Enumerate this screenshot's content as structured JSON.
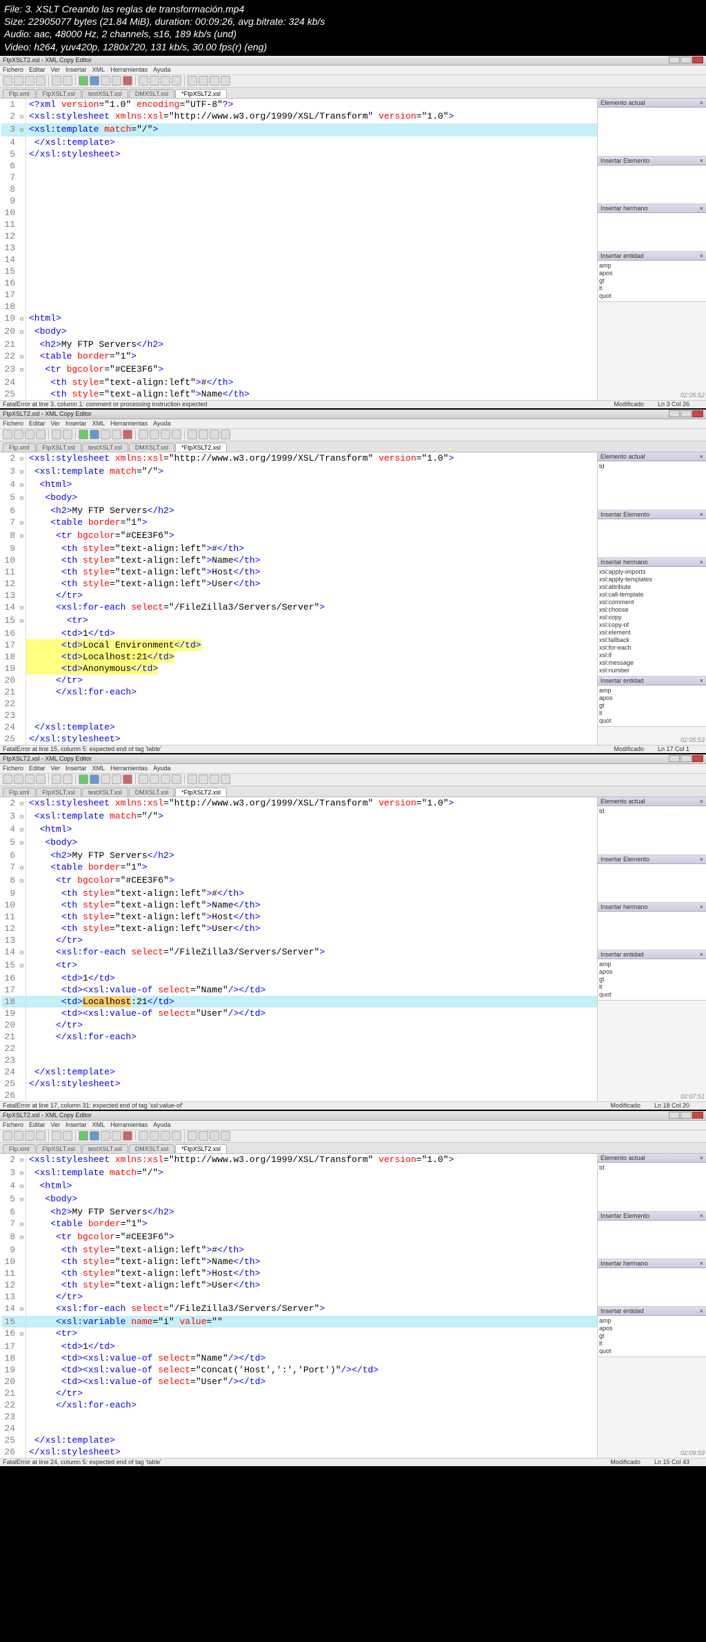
{
  "header": {
    "file": "File: 3. XSLT Creando las reglas de transformación.mp4",
    "size": "Size: 22905077 bytes (21.84 MiB), duration: 00:09:26, avg.bitrate: 324 kb/s",
    "audio": "Audio: aac, 48000 Hz, 2 channels, s16, 189 kb/s (und)",
    "video": "Video: h264, yuv420p, 1280x720, 131 kb/s, 30.00 fps(r) (eng)"
  },
  "app_title": "FtpXSLT2.xsl - XML Copy Editor",
  "menus": [
    "Fichero",
    "Editar",
    "Ver",
    "Insertar",
    "XML",
    "Herramientas",
    "Ayuda"
  ],
  "tabset": [
    "Ftp.xml",
    "FtpXSLT.xsl",
    "testXSLT.xsl",
    "DMXSLT.xsl",
    "*FtpXSLT2.xsl"
  ],
  "panels": {
    "p1": "Elemento actual",
    "p2": "Insertar Elemento",
    "p3": "Insertar hermano",
    "p4": "Insertar entidad",
    "ent": [
      "amp",
      "apos",
      "gt",
      "lt",
      "quot"
    ],
    "sib": [
      "xsl:apply-imports",
      "xsl:apply-templates",
      "xsl:attribute",
      "xsl:call-template",
      "xsl:comment",
      "xsl:choose",
      "xsl:copy",
      "xsl:copy-of",
      "xsl:element",
      "xsl:fallback",
      "xsl:for-each",
      "xsl:if",
      "xsl:message",
      "xsl:number"
    ]
  },
  "frames": [
    {
      "code": [
        {
          "n": 1,
          "f": "",
          "c": "<span class='tg'>&lt;?xml</span> <span class='attn'>version</span>=<span class='attv'>\"1.0\"</span> <span class='attn'>encoding</span>=<span class='attv'>\"UTF-8\"</span><span class='tg'>?&gt;</span>"
        },
        {
          "n": 2,
          "f": "m",
          "c": "<span class='tg'>&lt;xsl:stylesheet</span> <span class='attn'>xmlns:xsl</span>=<span class='attv'>\"http://www.w3.org/1999/XSL/Transform\"</span> <span class='attn'>version</span>=<span class='attv'>\"1.0\"</span><span class='tg'>&gt;</span>"
        },
        {
          "n": 3,
          "f": "m",
          "hl": "current",
          "c": "<span class='tg'>&lt;xsl:template</span> <span class='attn'>match</span>=<span class='attv'>\"/\"</span><span class='tg'>&gt;</span>"
        },
        {
          "n": 4,
          "f": "",
          "c": " <span class='tg'>&lt;/xsl:template&gt;</span>"
        },
        {
          "n": 5,
          "f": "",
          "c": "<span class='tg'>&lt;/xsl:stylesheet&gt;</span>"
        },
        {
          "n": 6,
          "f": "",
          "c": ""
        },
        {
          "n": 7,
          "f": "",
          "c": ""
        },
        {
          "n": 8,
          "f": "",
          "c": ""
        },
        {
          "n": 9,
          "f": "",
          "c": ""
        },
        {
          "n": 10,
          "f": "",
          "c": ""
        },
        {
          "n": 11,
          "f": "",
          "c": ""
        },
        {
          "n": 12,
          "f": "",
          "c": ""
        },
        {
          "n": 13,
          "f": "",
          "c": ""
        },
        {
          "n": 14,
          "f": "",
          "c": ""
        },
        {
          "n": 15,
          "f": "",
          "c": ""
        },
        {
          "n": 16,
          "f": "",
          "c": ""
        },
        {
          "n": 17,
          "f": "",
          "c": ""
        },
        {
          "n": 18,
          "f": "",
          "c": ""
        },
        {
          "n": 19,
          "f": "m",
          "c": "<span class='tg'>&lt;html&gt;</span>"
        },
        {
          "n": 20,
          "f": "m",
          "c": " <span class='tg'>&lt;body&gt;</span>"
        },
        {
          "n": 21,
          "f": "",
          "c": "  <span class='tg'>&lt;h2&gt;</span>My FTP Servers<span class='tg'>&lt;/h2&gt;</span>"
        },
        {
          "n": 22,
          "f": "m",
          "c": "  <span class='tg'>&lt;table</span> <span class='attn'>border</span>=<span class='attv'>\"1\"</span><span class='tg'>&gt;</span>"
        },
        {
          "n": 23,
          "f": "m",
          "c": "   <span class='tg'>&lt;tr</span> <span class='attn'>bgcolor</span>=<span class='attv'>\"#CEE3F6\"</span><span class='tg'>&gt;</span>"
        },
        {
          "n": 24,
          "f": "",
          "c": "    <span class='tg'>&lt;th</span> <span class='attn'>style</span>=<span class='attv'>\"text-align:left\"</span><span class='tg'>&gt;</span>#<span class='tg'>&lt;/th&gt;</span>"
        },
        {
          "n": 25,
          "f": "",
          "c": "    <span class='tg'>&lt;th</span> <span class='attn'>style</span>=<span class='attv'>\"text-align:left\"</span><span class='tg'>&gt;</span>Name<span class='tg'>&lt;/th&gt;</span>"
        }
      ],
      "status_left": "FatalError at line 3, column 1: comment or processing instruction expected",
      "status_mid": "Modificado",
      "status_right": "Ln 3 Col 26",
      "ts": "02:05:52"
    },
    {
      "code": [
        {
          "n": 2,
          "f": "m",
          "c": "<span class='tg'>&lt;xsl:stylesheet</span> <span class='attn'>xmlns:xsl</span>=<span class='attv'>\"http://www.w3.org/1999/XSL/Transform\"</span> <span class='attn'>version</span>=<span class='attv'>\"1.0\"</span><span class='tg'>&gt;</span>"
        },
        {
          "n": 3,
          "f": "m",
          "c": " <span class='tg'>&lt;xsl:template</span> <span class='attn'>match</span>=<span class='attv'>\"/\"</span><span class='tg'>&gt;</span>"
        },
        {
          "n": 4,
          "f": "m",
          "c": "  <span class='tg'>&lt;html&gt;</span>"
        },
        {
          "n": 5,
          "f": "m",
          "c": "   <span class='tg'>&lt;body&gt;</span>"
        },
        {
          "n": 6,
          "f": "",
          "c": "    <span class='tg'>&lt;h2&gt;</span>My FTP Servers<span class='tg'>&lt;/h2&gt;</span>"
        },
        {
          "n": 7,
          "f": "m",
          "c": "    <span class='tg'>&lt;table</span> <span class='attn'>border</span>=<span class='attv'>\"1\"</span><span class='tg'>&gt;</span>"
        },
        {
          "n": 8,
          "f": "m",
          "c": "     <span class='tg'>&lt;tr</span> <span class='attn'>bgcolor</span>=<span class='attv'>\"#CEE3F6\"</span><span class='tg'>&gt;</span>"
        },
        {
          "n": 9,
          "f": "",
          "c": "      <span class='tg'>&lt;th</span> <span class='attn'>style</span>=<span class='attv'>\"text-align:left\"</span><span class='tg'>&gt;</span>#<span class='tg'>&lt;/th&gt;</span>"
        },
        {
          "n": 10,
          "f": "",
          "c": "      <span class='tg'>&lt;th</span> <span class='attn'>style</span>=<span class='attv'>\"text-align:left\"</span><span class='tg'>&gt;</span>Name<span class='tg'>&lt;/th&gt;</span>"
        },
        {
          "n": 11,
          "f": "",
          "c": "      <span class='tg'>&lt;th</span> <span class='attn'>style</span>=<span class='attv'>\"text-align:left\"</span><span class='tg'>&gt;</span>Host<span class='tg'>&lt;/th&gt;</span>"
        },
        {
          "n": 12,
          "f": "",
          "c": "      <span class='tg'>&lt;th</span> <span class='attn'>style</span>=<span class='attv'>\"text-align:left\"</span><span class='tg'>&gt;</span>User<span class='tg'>&lt;/th&gt;</span>"
        },
        {
          "n": 13,
          "f": "",
          "c": "     <span class='tg'>&lt;/tr&gt;</span>"
        },
        {
          "n": 14,
          "f": "m",
          "c": "     <span class='tg'>&lt;xsl:for-each</span> <span class='attn'>select</span>=<span class='attv'>\"/FileZilla3/Servers/Server\"</span><span class='tg'>&gt;</span>"
        },
        {
          "n": 15,
          "f": "m",
          "c": "       <span class='tg'>&lt;tr&gt;</span>"
        },
        {
          "n": 16,
          "f": "",
          "c": "      <span class='tg'>&lt;td&gt;</span>1<span class='tg'>&lt;/td&gt;</span>"
        },
        {
          "n": 17,
          "f": "",
          "hl": "yellow",
          "c": "      <span class='tg'>&lt;td&gt;</span>Local Environment<span class='tg'>&lt;/td&gt;</span>"
        },
        {
          "n": 18,
          "f": "",
          "hl": "yellow",
          "c": "      <span class='tg'>&lt;td&gt;</span>Localhost:21<span class='tg'>&lt;/td&gt;</span>"
        },
        {
          "n": 19,
          "f": "",
          "hl": "yellow",
          "c": "      <span class='tg'>&lt;td&gt;</span>Anonymous<span class='tg'>&lt;/td&gt;</span>"
        },
        {
          "n": 20,
          "f": "",
          "c": "     <span class='tg'>&lt;/tr&gt;</span>"
        },
        {
          "n": 21,
          "f": "",
          "c": "     <span class='tg'>&lt;/xsl:for-each&gt;</span>"
        },
        {
          "n": 22,
          "f": "",
          "c": ""
        },
        {
          "n": 23,
          "f": "",
          "c": ""
        },
        {
          "n": 24,
          "f": "",
          "c": " <span class='tg'>&lt;/xsl:template&gt;</span>"
        },
        {
          "n": 25,
          "f": "",
          "c": "<span class='tg'>&lt;/xsl:stylesheet&gt;</span>"
        }
      ],
      "status_left": "FatalError at line 15, column 5: expected end of tag 'table'",
      "status_mid": "Modificado",
      "status_right": "Ln 17 Col 1",
      "ts": "02:05:53",
      "side_sib": true
    },
    {
      "code": [
        {
          "n": 2,
          "f": "m",
          "c": "<span class='tg'>&lt;xsl:stylesheet</span> <span class='attn'>xmlns:xsl</span>=<span class='attv'>\"http://www.w3.org/1999/XSL/Transform\"</span> <span class='attn'>version</span>=<span class='attv'>\"1.0\"</span><span class='tg'>&gt;</span>"
        },
        {
          "n": 3,
          "f": "m",
          "c": " <span class='tg'>&lt;xsl:template</span> <span class='attn'>match</span>=<span class='attv'>\"/\"</span><span class='tg'>&gt;</span>"
        },
        {
          "n": 4,
          "f": "m",
          "c": "  <span class='tg'>&lt;html&gt;</span>"
        },
        {
          "n": 5,
          "f": "m",
          "c": "   <span class='tg'>&lt;body&gt;</span>"
        },
        {
          "n": 6,
          "f": "",
          "c": "    <span class='tg'>&lt;h2&gt;</span>My FTP Servers<span class='tg'>&lt;/h2&gt;</span>"
        },
        {
          "n": 7,
          "f": "m",
          "c": "    <span class='tg'>&lt;table</span> <span class='attn'>border</span>=<span class='attv'>\"1\"</span><span class='tg'>&gt;</span>"
        },
        {
          "n": 8,
          "f": "m",
          "c": "     <span class='tg'>&lt;tr</span> <span class='attn'>bgcolor</span>=<span class='attv'>\"#CEE3F6\"</span><span class='tg'>&gt;</span>"
        },
        {
          "n": 9,
          "f": "",
          "c": "      <span class='tg'>&lt;th</span> <span class='attn'>style</span>=<span class='attv'>\"text-align:left\"</span><span class='tg'>&gt;</span>#<span class='tg'>&lt;/th&gt;</span>"
        },
        {
          "n": 10,
          "f": "",
          "c": "      <span class='tg'>&lt;th</span> <span class='attn'>style</span>=<span class='attv'>\"text-align:left\"</span><span class='tg'>&gt;</span>Name<span class='tg'>&lt;/th&gt;</span>"
        },
        {
          "n": 11,
          "f": "",
          "c": "      <span class='tg'>&lt;th</span> <span class='attn'>style</span>=<span class='attv'>\"text-align:left\"</span><span class='tg'>&gt;</span>Host<span class='tg'>&lt;/th&gt;</span>"
        },
        {
          "n": 12,
          "f": "",
          "c": "      <span class='tg'>&lt;th</span> <span class='attn'>style</span>=<span class='attv'>\"text-align:left\"</span><span class='tg'>&gt;</span>User<span class='tg'>&lt;/th&gt;</span>"
        },
        {
          "n": 13,
          "f": "",
          "c": "     <span class='tg'>&lt;/tr&gt;</span>"
        },
        {
          "n": 14,
          "f": "m",
          "c": "     <span class='tg'>&lt;xsl:for-each</span> <span class='attn'>select</span>=<span class='attv'>\"/FileZilla3/Servers/Server\"</span><span class='tg'>&gt;</span>"
        },
        {
          "n": 15,
          "f": "m",
          "c": "     <span class='tg'>&lt;tr&gt;</span>"
        },
        {
          "n": 16,
          "f": "",
          "c": "      <span class='tg'>&lt;td&gt;</span>1<span class='tg'>&lt;/td&gt;</span>"
        },
        {
          "n": 17,
          "f": "",
          "c": "      <span class='tg'>&lt;td&gt;&lt;xsl:value-of</span> <span class='attn'>select</span>=<span class='attv'>\"Name\"</span><span class='tg'>/&gt;&lt;/td&gt;</span>"
        },
        {
          "n": 18,
          "f": "",
          "hl": "current",
          "c": "      <span class='tg'>&lt;td&gt;</span><span class='mark' style='background:#ffcc66'>Localhost</span>:21<span class='tg'>&lt;/td&gt;</span>"
        },
        {
          "n": 19,
          "f": "",
          "c": "      <span class='tg'>&lt;td&gt;&lt;xsl:value-of</span> <span class='attn'>select</span>=<span class='attv'>\"User\"</span><span class='tg'>/&gt;&lt;/td&gt;</span>"
        },
        {
          "n": 20,
          "f": "",
          "c": "     <span class='tg'>&lt;/tr&gt;</span>"
        },
        {
          "n": 21,
          "f": "",
          "c": "     <span class='tg'>&lt;/xsl:for-each&gt;</span>"
        },
        {
          "n": 22,
          "f": "",
          "c": ""
        },
        {
          "n": 23,
          "f": "",
          "c": ""
        },
        {
          "n": 24,
          "f": "",
          "c": " <span class='tg'>&lt;/xsl:template&gt;</span>"
        },
        {
          "n": 25,
          "f": "",
          "c": "<span class='tg'>&lt;/xsl:stylesheet&gt;</span>"
        },
        {
          "n": 26,
          "f": "",
          "c": ""
        }
      ],
      "status_left": "FatalError at line 17, column 31: expected end of tag 'xsl:value-of'",
      "status_mid": "Modificado",
      "status_right": "Ln 18 Col 20",
      "ts": "02:07:51"
    },
    {
      "code": [
        {
          "n": 2,
          "f": "m",
          "c": "<span class='tg'>&lt;xsl:stylesheet</span> <span class='attn'>xmlns:xsl</span>=<span class='attv'>\"http://www.w3.org/1999/XSL/Transform\"</span> <span class='attn'>version</span>=<span class='attv'>\"1.0\"</span><span class='tg'>&gt;</span>"
        },
        {
          "n": 3,
          "f": "m",
          "c": " <span class='tg'>&lt;xsl:template</span> <span class='attn'>match</span>=<span class='attv'>\"/\"</span><span class='tg'>&gt;</span>"
        },
        {
          "n": 4,
          "f": "m",
          "c": "  <span class='tg'>&lt;html&gt;</span>"
        },
        {
          "n": 5,
          "f": "m",
          "c": "   <span class='tg'>&lt;body&gt;</span>"
        },
        {
          "n": 6,
          "f": "",
          "c": "    <span class='tg'>&lt;h2&gt;</span>My FTP Servers<span class='tg'>&lt;/h2&gt;</span>"
        },
        {
          "n": 7,
          "f": "m",
          "c": "    <span class='tg'>&lt;table</span> <span class='attn'>border</span>=<span class='attv'>\"1\"</span><span class='tg'>&gt;</span>"
        },
        {
          "n": 8,
          "f": "m",
          "c": "     <span class='tg'>&lt;tr</span> <span class='attn'>bgcolor</span>=<span class='attv'>\"#CEE3F6\"</span><span class='tg'>&gt;</span>"
        },
        {
          "n": 9,
          "f": "",
          "c": "      <span class='tg'>&lt;th</span> <span class='attn'>style</span>=<span class='attv'>\"text-align:left\"</span><span class='tg'>&gt;</span>#<span class='tg'>&lt;/th&gt;</span>"
        },
        {
          "n": 10,
          "f": "",
          "c": "      <span class='tg'>&lt;th</span> <span class='attn'>style</span>=<span class='attv'>\"text-align:left\"</span><span class='tg'>&gt;</span>Name<span class='tg'>&lt;/th&gt;</span>"
        },
        {
          "n": 11,
          "f": "",
          "c": "      <span class='tg'>&lt;th</span> <span class='attn'>style</span>=<span class='attv'>\"text-align:left\"</span><span class='tg'>&gt;</span>Host<span class='tg'>&lt;/th&gt;</span>"
        },
        {
          "n": 12,
          "f": "",
          "c": "      <span class='tg'>&lt;th</span> <span class='attn'>style</span>=<span class='attv'>\"text-align:left\"</span><span class='tg'>&gt;</span>User<span class='tg'>&lt;/th&gt;</span>"
        },
        {
          "n": 13,
          "f": "",
          "c": "     <span class='tg'>&lt;/tr&gt;</span>"
        },
        {
          "n": 14,
          "f": "m",
          "c": "     <span class='tg'>&lt;xsl:for-each</span> <span class='attn'>select</span>=<span class='attv'>\"/FileZilla3/Servers/Server\"</span><span class='tg'>&gt;</span>"
        },
        {
          "n": 15,
          "f": "",
          "hl": "current",
          "c": "     <span class='tg'>&lt;xsl:variable</span> <span class='attn'>name</span>=<span class='attv'>\"i\"</span> <span class='attn'>value</span>=<span class='attv'>\"\"</span>"
        },
        {
          "n": 16,
          "f": "m",
          "c": "     <span class='tg'>&lt;tr&gt;</span>"
        },
        {
          "n": 17,
          "f": "",
          "c": "      <span class='tg'>&lt;td&gt;</span>1<span class='tg'>&lt;/td&gt;</span>"
        },
        {
          "n": 18,
          "f": "",
          "c": "      <span class='tg'>&lt;td&gt;&lt;xsl:value-of</span> <span class='attn'>select</span>=<span class='attv'>\"Name\"</span><span class='tg'>/&gt;&lt;/td&gt;</span>"
        },
        {
          "n": 19,
          "f": "",
          "c": "      <span class='tg'>&lt;td&gt;&lt;xsl:value-of</span> <span class='attn'>select</span>=<span class='attv'>\"concat('Host',':','Port')\"</span><span class='tg'>/&gt;&lt;/td&gt;</span>"
        },
        {
          "n": 20,
          "f": "",
          "c": "      <span class='tg'>&lt;td&gt;&lt;xsl:value-of</span> <span class='attn'>select</span>=<span class='attv'>\"User\"</span><span class='tg'>/&gt;&lt;/td&gt;</span>"
        },
        {
          "n": 21,
          "f": "",
          "c": "     <span class='tg'>&lt;/tr&gt;</span>"
        },
        {
          "n": 22,
          "f": "",
          "c": "     <span class='tg'>&lt;/xsl:for-each&gt;</span>"
        },
        {
          "n": 23,
          "f": "",
          "c": ""
        },
        {
          "n": 24,
          "f": "",
          "c": ""
        },
        {
          "n": 25,
          "f": "",
          "c": " <span class='tg'>&lt;/xsl:template&gt;</span>"
        },
        {
          "n": 26,
          "f": "",
          "c": "<span class='tg'>&lt;/xsl:stylesheet&gt;</span>"
        }
      ],
      "status_left": "FatalError at line 24, column 5: expected end of tag 'table'",
      "status_mid": "Modificado",
      "status_right": "Ln 15 Col 43",
      "ts": "02:09:59"
    }
  ]
}
